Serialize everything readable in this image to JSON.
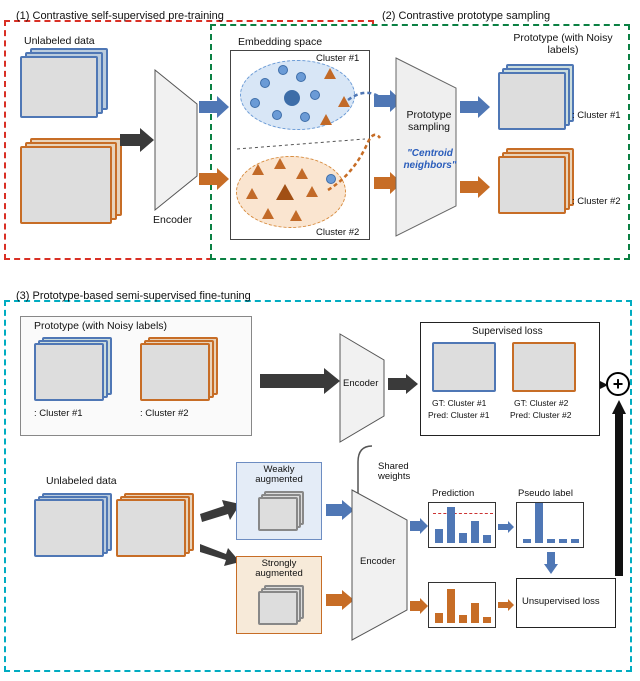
{
  "sections": {
    "s1": {
      "title": "(1) Contrastive self-supervised pre-training"
    },
    "s2": {
      "title": "(2) Contrastive prototype sampling"
    },
    "s3": {
      "title": "(3) Prototype-based semi-supervised fine-tuning"
    }
  },
  "labels": {
    "unlabeled": "Unlabeled data",
    "encoder": "Encoder",
    "embedding": "Embedding space",
    "cluster1": "Cluster #1",
    "cluster2": "Cluster #2",
    "proto_sampling": "Prototype sampling",
    "centroid": "\"Centroid neighbors\"",
    "prototype": "Prototype (with Noisy labels)",
    "proto_noisy": "Prototype (with Noisy labels)",
    "cluster1_pfx": ": Cluster #1",
    "cluster2_pfx": ": Cluster #2",
    "weakly": "Weakly augmented",
    "strongly": "Strongly augmented",
    "shared": "Shared weights",
    "sup_loss": "Supervised loss",
    "gt1": "GT: Cluster #1",
    "gt2": "GT: Cluster #2",
    "pred1": "Pred: Cluster #1",
    "pred2": "Pred: Cluster #2",
    "prediction": "Prediction",
    "pseudo": "Pseudo label",
    "unsup_loss": "Unsupervised loss",
    "plus": "+"
  }
}
